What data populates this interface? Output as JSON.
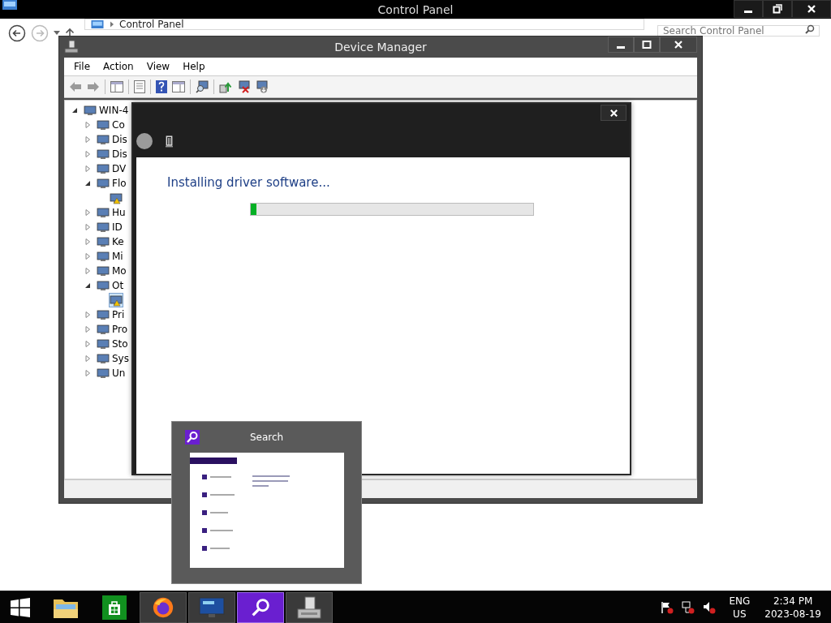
{
  "control_panel": {
    "title": "Control Panel",
    "address": "Control Panel",
    "search": {
      "placeholder": "Search Control Panel"
    }
  },
  "device_manager": {
    "title": "Device Manager",
    "menu": [
      "File",
      "Action",
      "View",
      "Help"
    ],
    "tree": [
      {
        "label": "WIN-4",
        "expanded": true,
        "selected": false,
        "children": [
          {
            "label": "Co",
            "expanded": false,
            "selected": false
          },
          {
            "label": "Dis",
            "expanded": false,
            "selected": false
          },
          {
            "label": "Dis",
            "expanded": false,
            "selected": false
          },
          {
            "label": "DV",
            "expanded": false,
            "selected": false
          },
          {
            "label": "Flo",
            "expanded": true,
            "selected": false,
            "children": [
              {
                "selected": false
              }
            ]
          },
          {
            "label": "Hu",
            "expanded": false,
            "selected": false
          },
          {
            "label": "ID",
            "expanded": false,
            "selected": false
          },
          {
            "label": "Ke",
            "expanded": false,
            "selected": false
          },
          {
            "label": "Mi",
            "expanded": false,
            "selected": false
          },
          {
            "label": "Mo",
            "expanded": false,
            "selected": false
          },
          {
            "label": "Ot",
            "expanded": true,
            "selected": false,
            "children": [
              {
                "selected": true
              }
            ]
          },
          {
            "label": "Pri",
            "expanded": false,
            "selected": false
          },
          {
            "label": "Pro",
            "expanded": false,
            "selected": false
          },
          {
            "label": "Sto",
            "expanded": false,
            "selected": false
          },
          {
            "label": "Sys",
            "expanded": false,
            "selected": false
          },
          {
            "label": "Un",
            "expanded": false,
            "selected": false
          }
        ]
      }
    ]
  },
  "driver_dialog": {
    "message": "Installing driver software...",
    "progress": {
      "level": 0.02
    }
  },
  "search_preview": {
    "title": "Search"
  },
  "taskbar": {
    "items": [
      {
        "kind": "start",
        "running": false,
        "selected": false
      },
      {
        "kind": "folder",
        "running": false,
        "selected": false
      },
      {
        "kind": "store",
        "running": false,
        "selected": false
      },
      {
        "kind": "browser",
        "running": true,
        "selected": false
      },
      {
        "kind": "display",
        "running": true,
        "selected": false
      },
      {
        "kind": "search",
        "running": true,
        "selected": true
      },
      {
        "kind": "device-manager",
        "running": true,
        "selected": false
      }
    ],
    "tray": {
      "language": "ENG",
      "region": "US",
      "time": "2:34 PM",
      "date": "2023-08-19"
    }
  }
}
